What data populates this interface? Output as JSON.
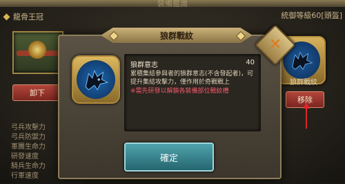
{
  "screen": {
    "title": "裝備鑑識"
  },
  "left_panel": {
    "header": "龍骨王冠",
    "unequip_button": "卸下",
    "stats": [
      "弓兵攻擊力",
      "弓兵防禦力",
      "軍團生命力",
      "研發速度",
      "騎兵生命力",
      "行軍速度"
    ]
  },
  "right_panel": {
    "header": "統御等級60[頭盔]",
    "badge_caption": "狼群戰紋",
    "move_button": "移除"
  },
  "dialog": {
    "title": "狼群戰紋",
    "close_icon": "close-x-icon",
    "item_icon": "wolf-emblem-icon",
    "info": {
      "name": "狼群意志",
      "value": "40",
      "description": "累積集結參與者的狼群意志(不含發起者)，可提升集結攻擊力，僅作用於奇戰戰上",
      "note": "※需先研發以解鎖各裝備部位戰紋槽"
    },
    "confirm_button": "確定"
  },
  "colors": {
    "accent_gold": "#cbb27a",
    "confirm_teal": "#3f8e98",
    "note_red": "#f05a6a",
    "close_orange": "#e07a1f"
  }
}
